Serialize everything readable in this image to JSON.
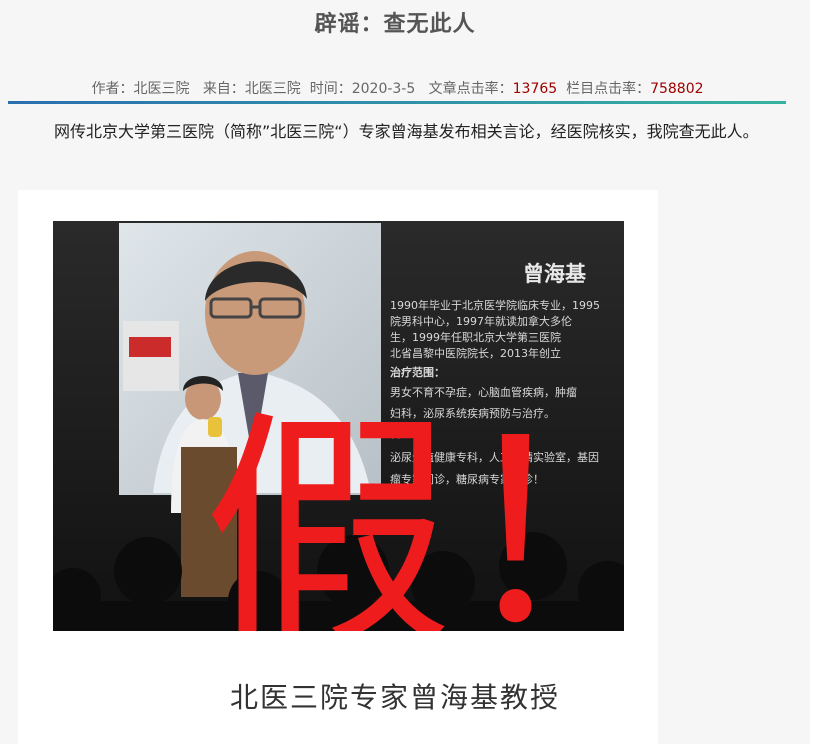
{
  "article": {
    "title": "辟谣：查无此人",
    "meta": {
      "author_label": "作者：",
      "author": "北医三院",
      "source_label": "来自：",
      "source": "北医三院",
      "time_label": "时间：",
      "time": "2020-3-5",
      "article_clicks_label": "文章点击率：",
      "article_clicks": "13765",
      "column_clicks_label": "栏目点击率：",
      "column_clicks": "758802"
    },
    "body": "网传北京大学第三医院（简称”北医三院“）专家曾海基发布相关言论，经医院核实，我院查无此人。"
  },
  "image": {
    "slide_name": "曾海基",
    "slide_lines": [
      "1990年毕业于北京医学院临床专业，1995",
      "院男科中心，1997年就读加拿大多伦",
      "生，1999年任职北京大学第三医院",
      "北省昌黎中医院院长，2013年创立"
    ],
    "range_heading": "治疗范围：",
    "range_lines": [
      "男女不育不孕症，心脑血管疾病，肿瘤",
      "妇科，泌尿系统疾病预防与治疗。"
    ],
    "dept_heading": "科：",
    "dept_lines": [
      "泌尿生殖健康专科，人工授精实验室，基因",
      "瘤专家门诊，糖尿病专家门诊！"
    ],
    "stamp": "假！",
    "caption": "北医三院专家曾海基教授"
  },
  "colors": {
    "stamp": "#ee1c1c",
    "accent_red": "#a00000",
    "rule_start": "#2a6fb0",
    "rule_end": "#35b3a0"
  }
}
